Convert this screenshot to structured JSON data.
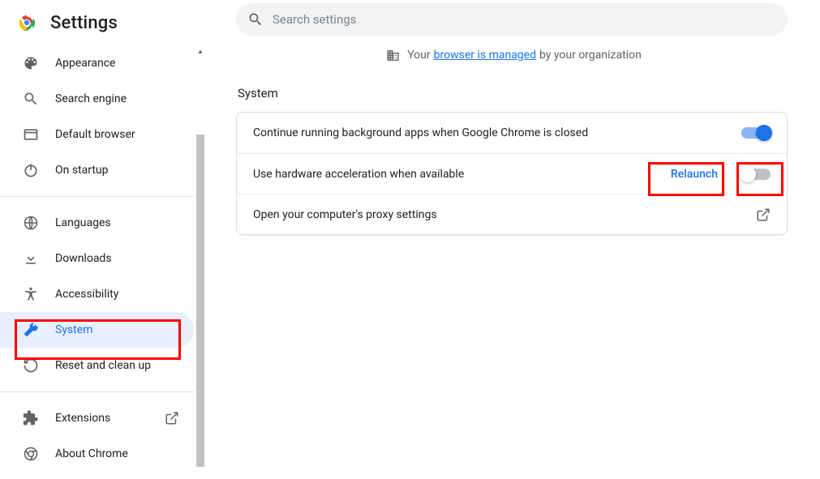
{
  "header": {
    "title": "Settings"
  },
  "search": {
    "placeholder": "Search settings"
  },
  "managed": {
    "prefix": "Your",
    "link": "browser is managed",
    "suffix": "by your organization"
  },
  "section_title": "System",
  "sidebar": {
    "items": [
      {
        "label": "Appearance",
        "icon": "palette"
      },
      {
        "label": "Search engine",
        "icon": "search"
      },
      {
        "label": "Default browser",
        "icon": "browser"
      },
      {
        "label": "On startup",
        "icon": "power"
      }
    ],
    "advanced": [
      {
        "label": "Languages",
        "icon": "globe"
      },
      {
        "label": "Downloads",
        "icon": "download"
      },
      {
        "label": "Accessibility",
        "icon": "accessibility"
      },
      {
        "label": "System",
        "icon": "wrench",
        "active": true
      },
      {
        "label": "Reset and clean up",
        "icon": "restore"
      }
    ],
    "footer": [
      {
        "label": "Extensions",
        "icon": "extension",
        "external": true
      },
      {
        "label": "About Chrome",
        "icon": "chrome"
      }
    ]
  },
  "rows": {
    "bg_apps": {
      "label": "Continue running background apps when Google Chrome is closed",
      "on": true
    },
    "hw_accel": {
      "label": "Use hardware acceleration when available",
      "on": false,
      "relaunch_label": "Relaunch"
    },
    "proxy": {
      "label": "Open your computer's proxy settings"
    }
  },
  "colors": {
    "accent": "#1a73e8",
    "highlight": "#ff0000"
  }
}
